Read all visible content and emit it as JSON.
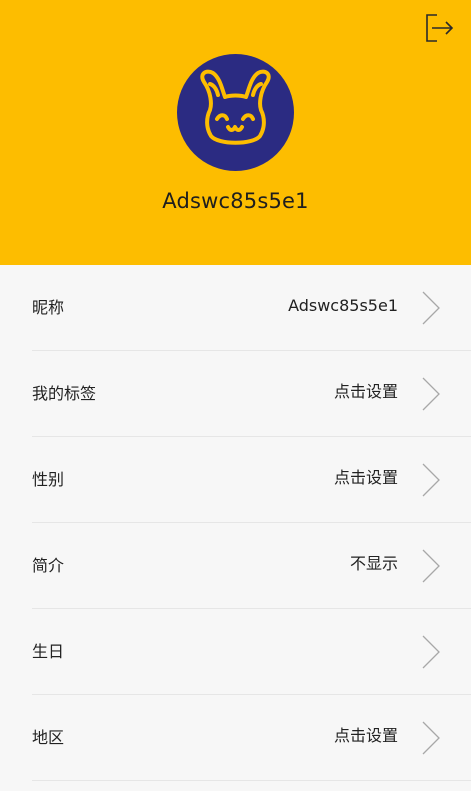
{
  "profile": {
    "username": "Adswc85s5e1",
    "header_color": "#fdbd00",
    "avatar_color": "#2b2b82",
    "avatar_icon": "bunny-face-icon",
    "logout_icon": "logout-icon"
  },
  "settings": {
    "items": [
      {
        "label": "昵称",
        "value": "Adswc85s5e1"
      },
      {
        "label": "我的标签",
        "value": "点击设置"
      },
      {
        "label": "性别",
        "value": "点击设置"
      },
      {
        "label": "简介",
        "value": "不显示"
      },
      {
        "label": "生日",
        "value": ""
      },
      {
        "label": "地区",
        "value": "点击设置"
      }
    ],
    "chevron_icon": "chevron-right-icon"
  }
}
